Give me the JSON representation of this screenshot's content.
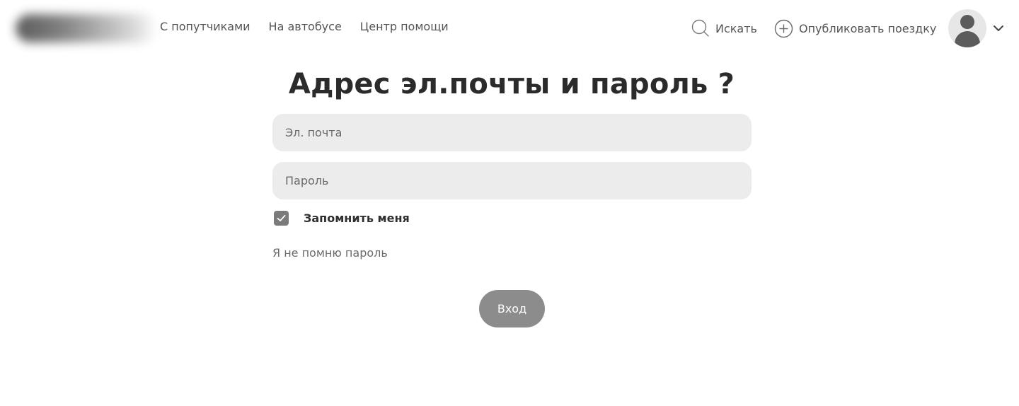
{
  "header": {
    "nav": {
      "carpool": "С попутчиками",
      "bus": "На автобусе",
      "help": "Центр помощи"
    },
    "search": {
      "label": "Искать",
      "icon": "search-icon"
    },
    "publish": {
      "label": "Опубликовать поездку",
      "icon": "plus-circle-icon"
    },
    "profile": {
      "icon": "avatar-icon",
      "menu_icon": "chevron-down-icon"
    }
  },
  "login": {
    "title": "Адрес эл.почты и пароль ?",
    "email_placeholder": "Эл. почта",
    "password_placeholder": "Пароль",
    "remember_label": "Запомнить меня",
    "remember_checked": true,
    "forgot_link": "Я не помню пароль",
    "submit_label": "Вход"
  },
  "colors": {
    "field_bg": "#ececec",
    "button_bg": "#8c8c8c",
    "checkbox_bg": "#7b7b7b",
    "text_dark": "#2b2b2b",
    "text_muted": "#555555"
  }
}
